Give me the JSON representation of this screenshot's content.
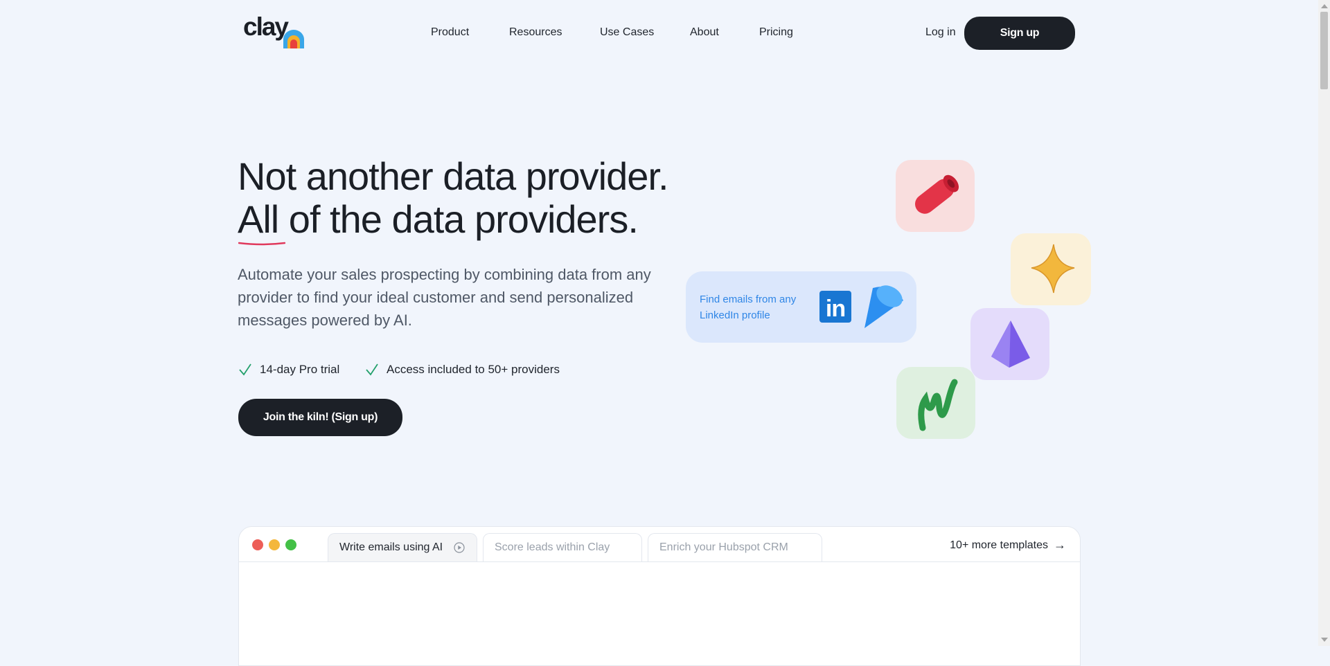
{
  "header": {
    "logo_text": "clay",
    "nav": [
      "Product",
      "Resources",
      "Use Cases",
      "About",
      "Pricing"
    ],
    "login_label": "Log in",
    "signup_label": "Sign up"
  },
  "hero": {
    "headline_line1": "Not another data provider.",
    "headline_line2": "All of the data providers.",
    "subtitle": "Automate your sales prospecting by combining data from any provider to find your ideal customer and send personalized messages powered by AI.",
    "checks": [
      "14-day Pro trial",
      "Access included to 50+ providers"
    ],
    "cta_label": "Join the kiln! (Sign up)"
  },
  "floating": {
    "linkedin_card_text": "Find emails from any LinkedIn profile",
    "linkedin_badge": "in",
    "icons": [
      "red-tube-icon",
      "yellow-star-icon",
      "purple-gem-icon",
      "green-squiggle-icon",
      "blue-cone-icon"
    ]
  },
  "window": {
    "tabs": [
      {
        "label": "Write emails using AI",
        "active": true
      },
      {
        "label": "Score leads within Clay",
        "active": false
      },
      {
        "label": "Enrich your Hubspot CRM",
        "active": false
      }
    ],
    "more_label": "10+ more templates"
  },
  "colors": {
    "background": "#f1f5fc",
    "primary_button": "#1c2027",
    "check_green": "#22a06b",
    "accent_red_underline": "#e0395c"
  }
}
